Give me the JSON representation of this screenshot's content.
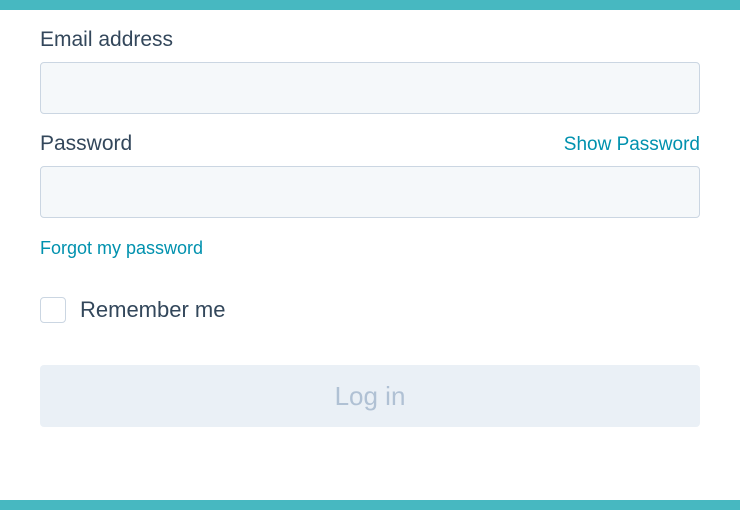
{
  "form": {
    "email": {
      "label": "Email address",
      "value": ""
    },
    "password": {
      "label": "Password",
      "show_toggle": "Show Password",
      "value": ""
    },
    "forgot_link": "Forgot my password",
    "remember": {
      "label": "Remember me",
      "checked": false
    },
    "submit_label": "Log in"
  },
  "colors": {
    "brand_bar": "#47b8c1",
    "link": "#0091ae",
    "text": "#33475b",
    "input_bg": "#f5f8fa",
    "input_border": "#cbd6e2",
    "button_bg": "#eaf0f6",
    "button_text": "#b0c1d4"
  }
}
